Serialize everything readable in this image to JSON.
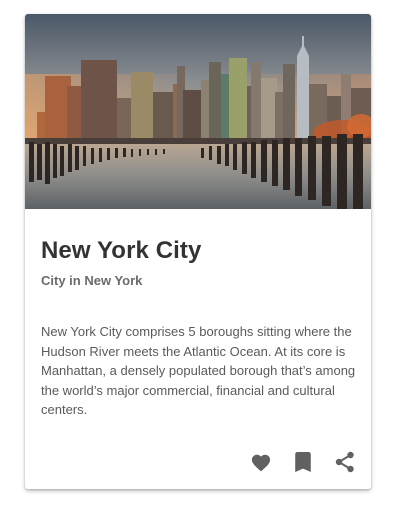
{
  "card": {
    "title": "New York City",
    "subtitle": "City in New York",
    "description": "New York City comprises 5 boroughs sitting where the Hudson River meets the Atlantic Ocean. At its core is Manhattan, a densely populated borough that’s among the world’s major commercial, financial and cultural centers.",
    "image": {
      "subject": "new-york-skyline-at-sunset"
    },
    "actions": [
      {
        "icon": "heart-icon"
      },
      {
        "icon": "bookmark-icon"
      },
      {
        "icon": "share-icon"
      }
    ]
  },
  "colors": {
    "title": "#333333",
    "subtitle": "#6b6b6b",
    "body_text": "#5a5a5a",
    "icons": "#616161",
    "card_background": "#ffffff"
  }
}
